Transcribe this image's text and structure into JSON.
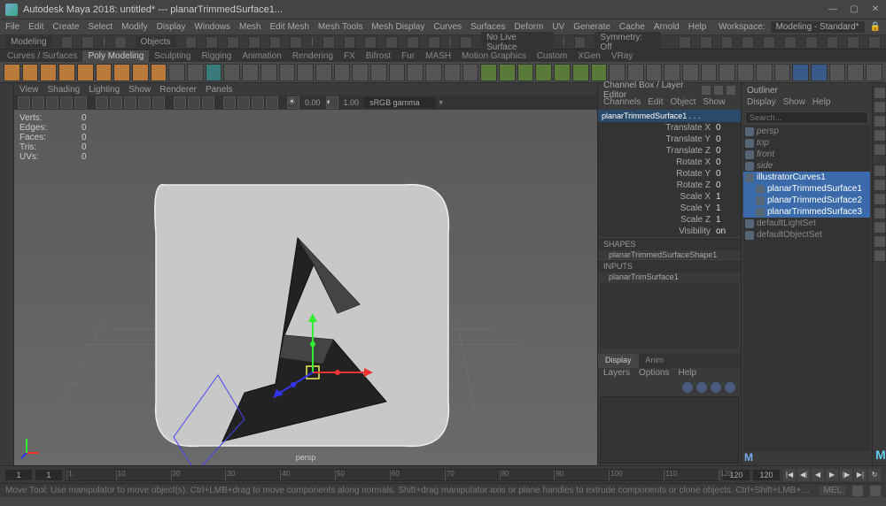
{
  "title": "Autodesk Maya 2018: untitled*  ---  planarTrimmedSurface1...",
  "menubar": [
    "File",
    "Edit",
    "Create",
    "Select",
    "Modify",
    "Display",
    "Windows",
    "Mesh",
    "Edit Mesh",
    "Mesh Tools",
    "Mesh Display",
    "Curves",
    "Surfaces",
    "Deform",
    "UV",
    "Generate",
    "Cache",
    "Arnold",
    "Help"
  ],
  "workspace_label": "Workspace:",
  "workspace_value": "Modeling - Standard*",
  "statusline": {
    "mode": "Modeling",
    "objects": "Objects",
    "live": "No Live Surface",
    "sym": "Symmetry: Off"
  },
  "shelf_tabs": [
    "Curves / Surfaces",
    "Poly Modeling",
    "Sculpting",
    "Rigging",
    "Animation",
    "Rendering",
    "FX",
    "Bifrost",
    "Fur",
    "MASH",
    "Motion Graphics",
    "Custom",
    "XGen",
    "VRay"
  ],
  "shelf_active": "Poly Modeling",
  "left_rail": [
    "Tool Settings",
    "Channel Box"
  ],
  "viewport_menu": [
    "View",
    "Shading",
    "Lighting",
    "Show",
    "Renderer",
    "Panels"
  ],
  "vp_vals": {
    "a": "0.00",
    "b": "1.00",
    "gamma": "sRGB gamma"
  },
  "hud": {
    "Verts": "0",
    "Edges": "0",
    "Faces": "0",
    "Tris": "0",
    "UVs": "0"
  },
  "camera": "persp",
  "channel_box": {
    "title": "Channel Box / Layer Editor",
    "menu": [
      "Channels",
      "Edit",
      "Object",
      "Show"
    ],
    "node": "planarTrimmedSurface1 . . .",
    "attrs": [
      {
        "n": "Translate X",
        "v": "0"
      },
      {
        "n": "Translate Y",
        "v": "0"
      },
      {
        "n": "Translate Z",
        "v": "0"
      },
      {
        "n": "Rotate X",
        "v": "0"
      },
      {
        "n": "Rotate Y",
        "v": "0"
      },
      {
        "n": "Rotate Z",
        "v": "0"
      },
      {
        "n": "Scale X",
        "v": "1"
      },
      {
        "n": "Scale Y",
        "v": "1"
      },
      {
        "n": "Scale Z",
        "v": "1"
      },
      {
        "n": "Visibility",
        "v": "on"
      }
    ],
    "shapes_h": "SHAPES",
    "shapes": "planarTrimmedSurfaceShape1",
    "inputs_h": "INPUTS",
    "inputs": "planarTrimSurface1",
    "display_tabs": [
      "Display",
      "Anim"
    ],
    "layer_menu": [
      "Layers",
      "Options",
      "Help"
    ]
  },
  "outliner": {
    "title": "Outliner",
    "menu": [
      "Display",
      "Show",
      "Help"
    ],
    "search_ph": "Search...",
    "items": [
      {
        "label": "persp",
        "indent": 0,
        "dim": true
      },
      {
        "label": "top",
        "indent": 0,
        "dim": true
      },
      {
        "label": "front",
        "indent": 0,
        "dim": true
      },
      {
        "label": "side",
        "indent": 0,
        "dim": true
      },
      {
        "label": "illustratorCurves1",
        "indent": 0,
        "selected": true
      },
      {
        "label": "planarTrimmedSurface1",
        "indent": 1,
        "selected": true
      },
      {
        "label": "planarTrimmedSurface2",
        "indent": 1,
        "selected": true
      },
      {
        "label": "planarTrimmedSurface3",
        "indent": 1,
        "selected": true
      },
      {
        "label": "defaultLightSet",
        "indent": 0
      },
      {
        "label": "defaultObjectSet",
        "indent": 0
      }
    ]
  },
  "timeline": {
    "start": "1",
    "end": "120",
    "ticks": [
      1,
      10,
      20,
      30,
      40,
      50,
      60,
      70,
      80,
      90,
      100,
      110,
      120
    ]
  },
  "help": "Move Tool: Use manipulator to move object(s). Ctrl+LMB+drag to move components along normals. Shift+drag manipulator axis or plane handles to extrude components or clone objects. Ctrl+Shift+LMB+drag t",
  "mel": "MEL"
}
